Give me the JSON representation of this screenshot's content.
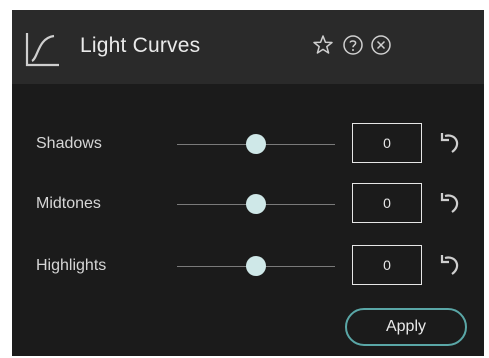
{
  "header": {
    "title": "Light Curves",
    "icons": [
      "curve-icon",
      "star-icon",
      "help-icon",
      "close-icon"
    ]
  },
  "adjustments": [
    {
      "label": "Shadows",
      "value": "0",
      "slider_position": 0.5
    },
    {
      "label": "Midtones",
      "value": "0",
      "slider_position": 0.5
    },
    {
      "label": "Highlights",
      "value": "0",
      "slider_position": 0.5
    }
  ],
  "footer": {
    "apply_label": "Apply"
  },
  "colors": {
    "panel_bg": "#1b1b1b",
    "header_bg": "#2a2a2a",
    "thumb": "#cfe8e8",
    "apply_border": "#5aa7a7"
  }
}
